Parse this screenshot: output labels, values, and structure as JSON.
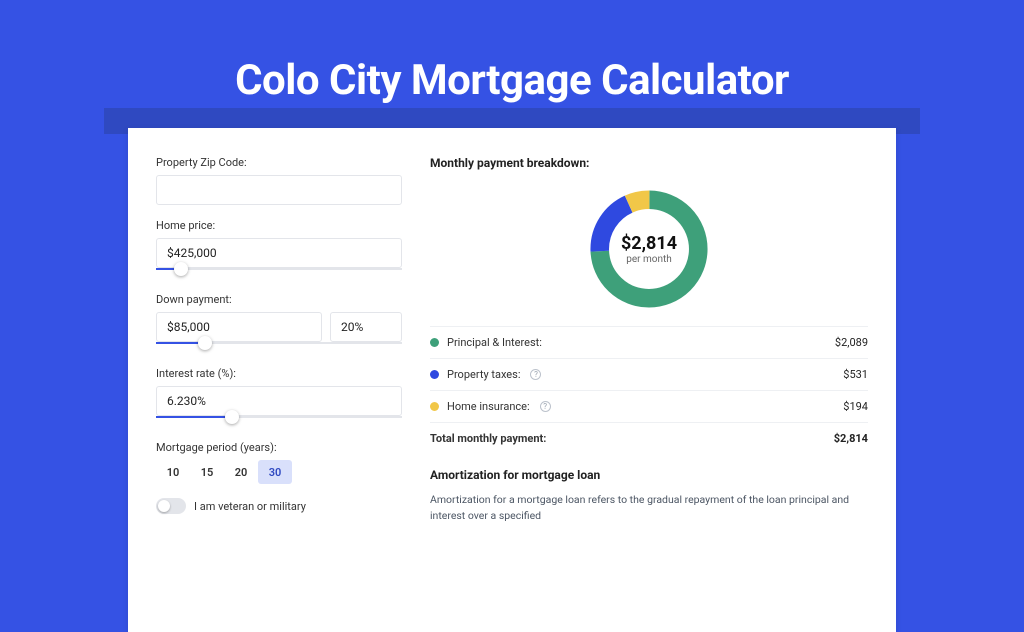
{
  "title": "Colo City Mortgage Calculator",
  "form": {
    "zip_label": "Property Zip Code:",
    "zip_value": "",
    "price_label": "Home price:",
    "price_value": "$425,000",
    "price_slider_pct": 10,
    "down_label": "Down payment:",
    "down_value": "$85,000",
    "down_pct_value": "20%",
    "down_slider_pct": 20,
    "rate_label": "Interest rate (%):",
    "rate_value": "6.230%",
    "rate_slider_pct": 31,
    "period_label": "Mortgage period (years):",
    "periods": [
      "10",
      "15",
      "20",
      "30"
    ],
    "period_active": 3,
    "veteran_label": "I am veteran or military"
  },
  "breakdown": {
    "title": "Monthly payment breakdown:",
    "center_amount": "$2,814",
    "center_sub": "per month",
    "items": [
      {
        "label": "Principal & Interest:",
        "value": "$2,089",
        "color": "#3ea07a",
        "info": false
      },
      {
        "label": "Property taxes:",
        "value": "$531",
        "color": "#2f49e0",
        "info": true
      },
      {
        "label": "Home insurance:",
        "value": "$194",
        "color": "#f1c748",
        "info": true
      }
    ],
    "total_label": "Total monthly payment:",
    "total_value": "$2,814"
  },
  "amort": {
    "title": "Amortization for mortgage loan",
    "text": "Amortization for a mortgage loan refers to the gradual repayment of the loan principal and interest over a specified"
  },
  "chart_data": {
    "type": "pie",
    "title": "Monthly payment breakdown",
    "series": [
      {
        "name": "Principal & Interest",
        "value": 2089
      },
      {
        "name": "Property taxes",
        "value": 531
      },
      {
        "name": "Home insurance",
        "value": 194
      }
    ],
    "total": 2814,
    "colors": [
      "#3ea07a",
      "#2f49e0",
      "#f1c748"
    ]
  }
}
